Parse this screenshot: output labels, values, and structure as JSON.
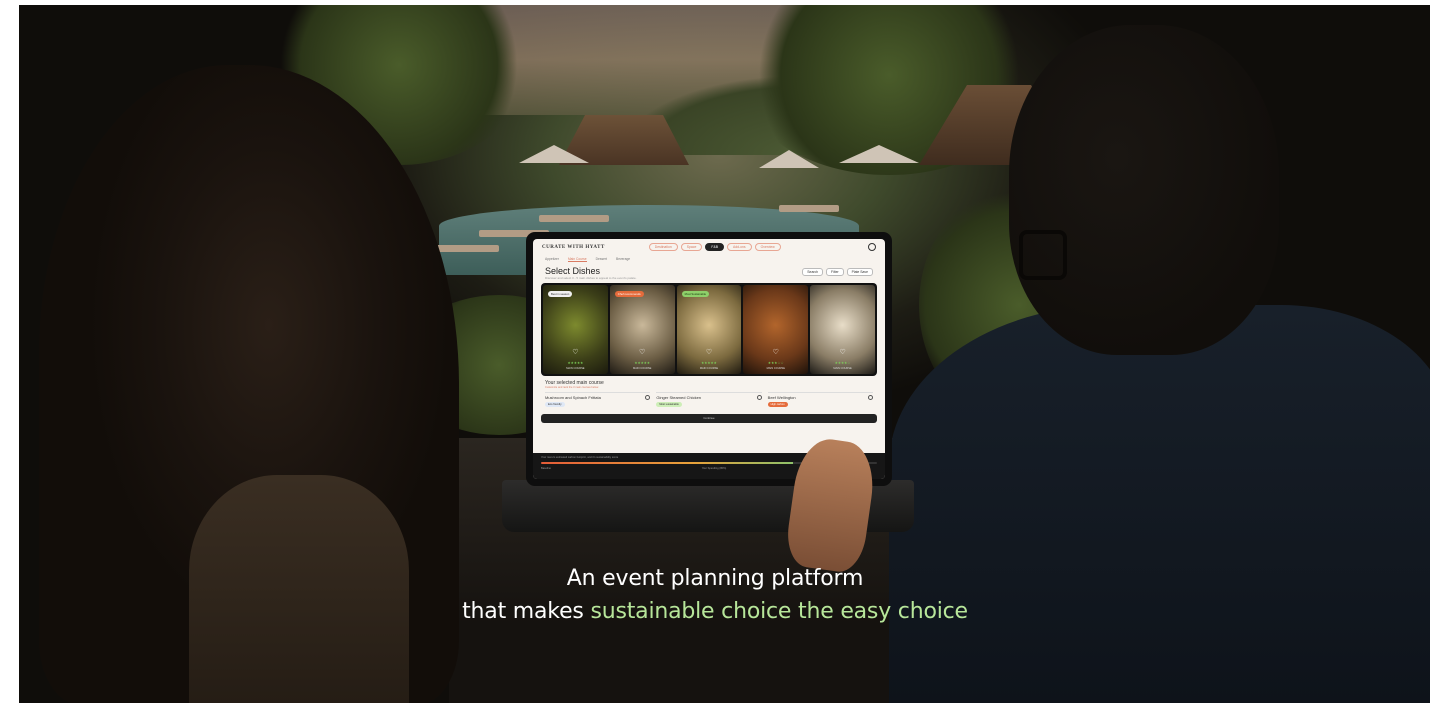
{
  "caption": {
    "line1": "An event planning platform",
    "line2_prefix": "that makes ",
    "line2_accent": "sustainable choice the easy choice",
    "accent_color": "#b7e69a"
  },
  "app": {
    "logo": "CURATE WITH HYATT",
    "nav": [
      "Destination",
      "Space",
      "F&B",
      "Add-ons",
      "Overview"
    ],
    "nav_active": "F&B",
    "tabs": [
      "Appetizer",
      "Main Course",
      "Dessert",
      "Beverage"
    ],
    "tab_active": "Main Course",
    "page_title": "Select Dishes",
    "page_subtitle": "Discover and select 3 - 5 main dishes to appeal to the event's palate.",
    "search_label": "Search",
    "filter_label": "Filter",
    "favorites_label": "Plate Save",
    "dishes": [
      {
        "tag": "Best in season",
        "stars": "★★★★★",
        "course": "MAIN COURSE",
        "tag_color": "#f1f1f1"
      },
      {
        "tag": "Chef recommends",
        "stars": "★★★★★",
        "course": "MAIN COURSE",
        "tag_color": "#e56b3b"
      },
      {
        "tag": "Most Sustainable",
        "stars": "★★★★★",
        "course": "MAIN COURSE",
        "tag_color": "#8ed06a"
      },
      {
        "tag": "",
        "stars": "★★★☆☆",
        "course": "MAIN COURSE",
        "tag_color": ""
      },
      {
        "tag": "",
        "stars": "★★★★☆",
        "course": "MAIN COURSE",
        "tag_color": ""
      }
    ],
    "selected_heading": "Your selected main course",
    "selected_sub": "Customize and rank the 3 main courses below.",
    "selected": [
      {
        "name": "Mushroom and Spinach Frittata",
        "badge": "Eco friendly",
        "badge_color": "#dfe8f6"
      },
      {
        "name": "Ginger Steamed Chicken",
        "badge": "Most sustainable",
        "badge_color": "#cdeeb7"
      },
      {
        "name": "Beef Wellington",
        "badge": "High carbon",
        "badge_color": "#e56b3b"
      }
    ],
    "next_bar": "Continue",
    "footer_note": "Your menu's estimated carbon footprint, and it's sustainability score",
    "footer_left": "Baseline",
    "footer_mid": "Your Spending (80%)",
    "sustainability_progress": 0.75,
    "sustainability_dots": 5
  }
}
